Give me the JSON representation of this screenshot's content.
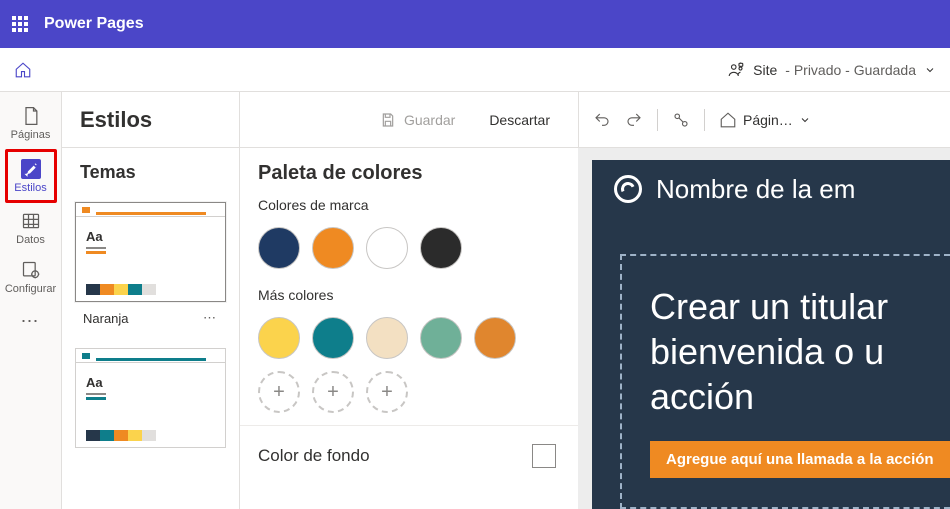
{
  "app": {
    "brand": "Power Pages"
  },
  "subbar": {
    "site_label": "Site",
    "status": " - Privado - Guardada"
  },
  "rail": {
    "pages": "Páginas",
    "styles": "Estilos",
    "data": "Datos",
    "configure": "Configurar"
  },
  "styles": {
    "title": "Estilos",
    "toolbar": {
      "save": "Guardar",
      "discard": "Descartar"
    },
    "themes": {
      "heading": "Temas",
      "items": [
        {
          "name": "Naranja",
          "accent": "#ef8a22",
          "aa_underline": "#ef8a22",
          "palette": [
            "#26374a",
            "#ef8a22",
            "#fbd34c",
            "#0e7e8b",
            "#e1dfdd"
          ]
        },
        {
          "name": "",
          "accent": "#0e7e8b",
          "aa_underline": "#0e7e8b",
          "palette": [
            "#26374a",
            "#0e7e8b",
            "#ef8a22",
            "#fbd34c",
            "#e1dfdd"
          ]
        }
      ]
    },
    "palette": {
      "heading": "Paleta de colores",
      "brand_label": "Colores de marca",
      "brand": [
        "#1f3a63",
        "#ef8a22",
        "#ffffff",
        "#2b2b2b"
      ],
      "more_label": "Más colores",
      "more": [
        "#fbd34c",
        "#0e7e8b",
        "#f3e0c2",
        "#6fb098",
        "#e0862e"
      ],
      "bg_label": "Color de fondo",
      "bg_value": "#ffffff"
    }
  },
  "preview": {
    "pages_dropdown": "Págin…",
    "site_name": "Nombre de la em",
    "headline_l1": "Crear un titular ",
    "headline_l2": "bienvenida o u",
    "headline_l3": "acción",
    "cta": "Agregue aquí una llamada a la acción"
  }
}
